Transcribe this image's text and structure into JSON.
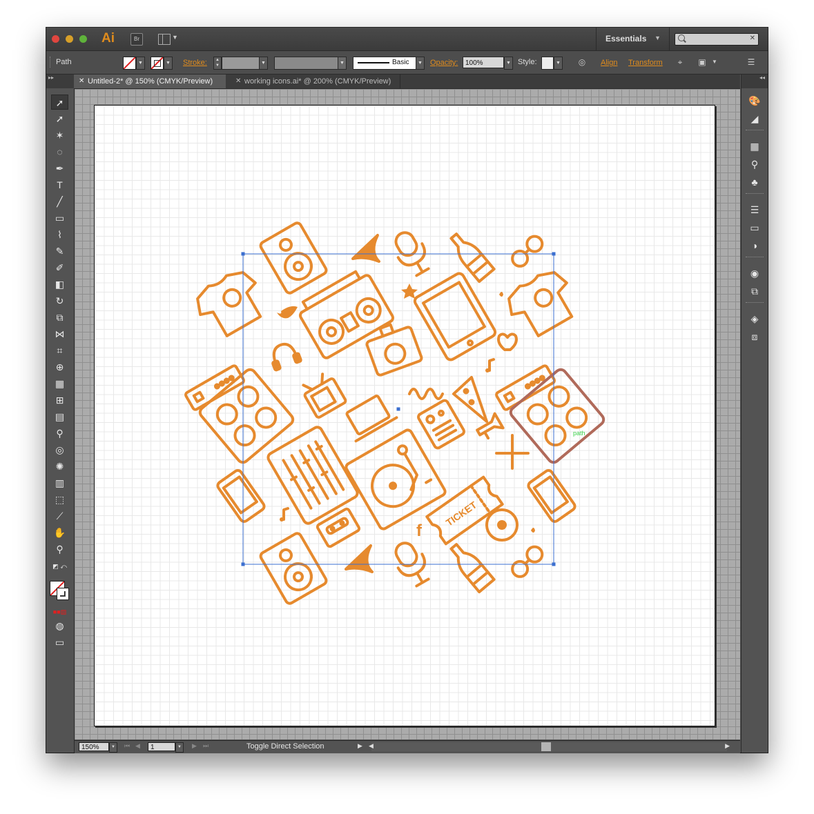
{
  "app": {
    "logo": "Ai",
    "bridge": "Br",
    "workspace": "Essentials",
    "search_placeholder": ""
  },
  "control_bar": {
    "selection_type": "Path",
    "stroke_label": "Stroke:",
    "brush_label": "Basic",
    "opacity_label": "Opacity:",
    "opacity_value": "100%",
    "style_label": "Style:",
    "align_label": "Align",
    "transform_label": "Transform"
  },
  "tabs": [
    {
      "label": "Untitled-2* @ 150% (CMYK/Preview)",
      "active": true
    },
    {
      "label": "working icons.ai* @ 200% (CMYK/Preview)",
      "active": false
    }
  ],
  "artwork": {
    "accent_color": "#e68a2e",
    "selection_color": "#3b6fd0",
    "ticket_text": "TICKET",
    "facebook_glyph": "f",
    "hover_label": "path"
  },
  "status_bar": {
    "zoom": "150%",
    "page": "1",
    "message": "Toggle Direct Selection"
  },
  "tools": [
    "selection-tool-icon",
    "direct-selection-tool-icon",
    "magic-wand-tool-icon",
    "lasso-tool-icon",
    "pen-tool-icon",
    "type-tool-icon",
    "line-tool-icon",
    "rectangle-tool-icon",
    "paintbrush-tool-icon",
    "pencil-tool-icon",
    "blob-brush-tool-icon",
    "eraser-tool-icon",
    "rotate-tool-icon",
    "scale-tool-icon",
    "width-tool-icon",
    "free-transform-tool-icon",
    "shape-builder-tool-icon",
    "perspective-grid-tool-icon",
    "mesh-tool-icon",
    "gradient-tool-icon",
    "eyedropper-tool-icon",
    "blend-tool-icon",
    "symbol-sprayer-tool-icon",
    "column-graph-tool-icon",
    "artboard-tool-icon",
    "slice-tool-icon",
    "hand-tool-icon",
    "zoom-tool-icon"
  ],
  "panels": [
    "color-panel-icon",
    "color-guide-panel-icon",
    "swatches-panel-icon",
    "brushes-panel-icon",
    "symbols-panel-icon",
    "stroke-panel-icon",
    "gradient-panel-icon",
    "transparency-panel-icon",
    "appearance-panel-icon",
    "graphic-styles-panel-icon",
    "layers-panel-icon",
    "artboards-panel-icon"
  ]
}
